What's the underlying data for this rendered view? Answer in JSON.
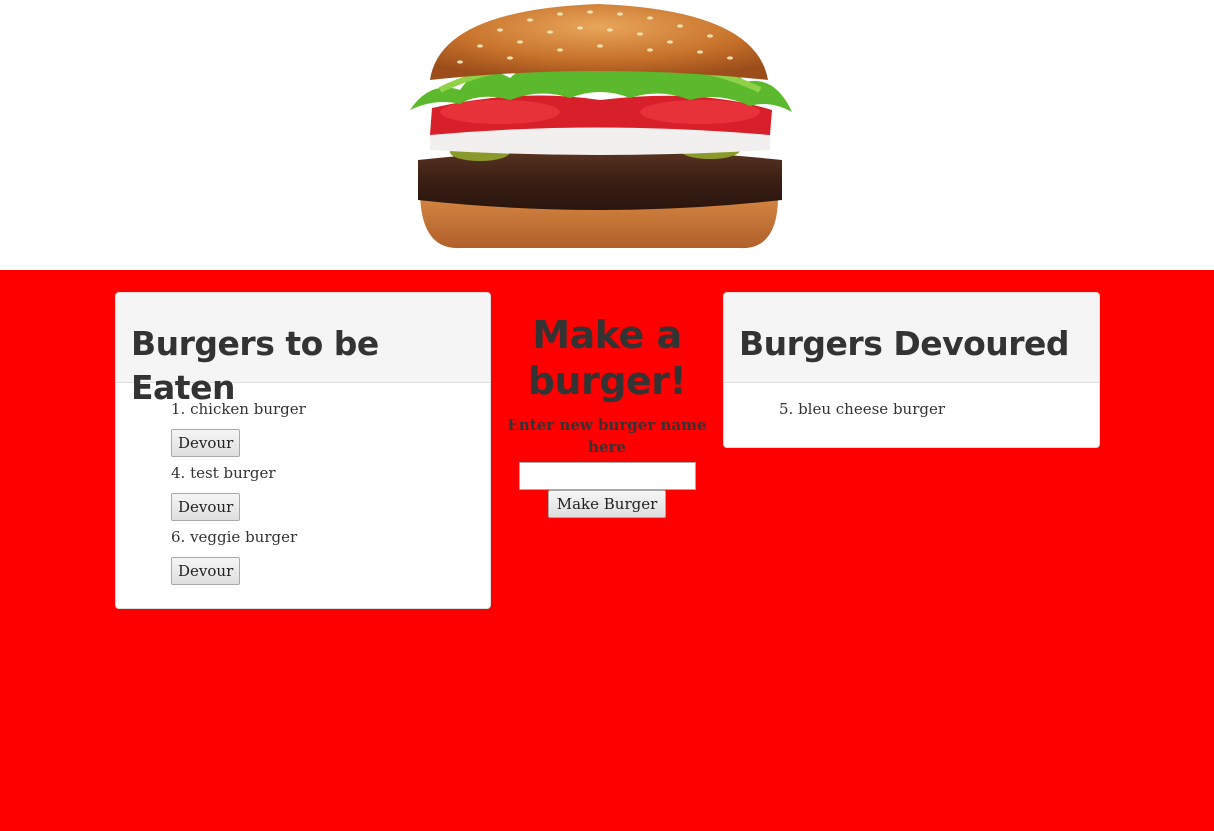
{
  "header": {
    "image": "burger-image"
  },
  "to_eat": {
    "title": "Burgers to be Eaten",
    "items": [
      {
        "label": "1. chicken burger",
        "button": "Devour"
      },
      {
        "label": "4. test burger",
        "button": "Devour"
      },
      {
        "label": "6. veggie burger",
        "button": "Devour"
      }
    ]
  },
  "form": {
    "title": "Make a burger!",
    "label": "Enter new burger name here",
    "input_value": "",
    "button": "Make Burger"
  },
  "devoured": {
    "title": "Burgers Devoured",
    "items": [
      {
        "label": "5. bleu cheese burger"
      }
    ]
  },
  "colors": {
    "background": "#ff0000",
    "panel": "#ffffff",
    "panel_heading": "#f5f5f5",
    "text": "#333333"
  }
}
